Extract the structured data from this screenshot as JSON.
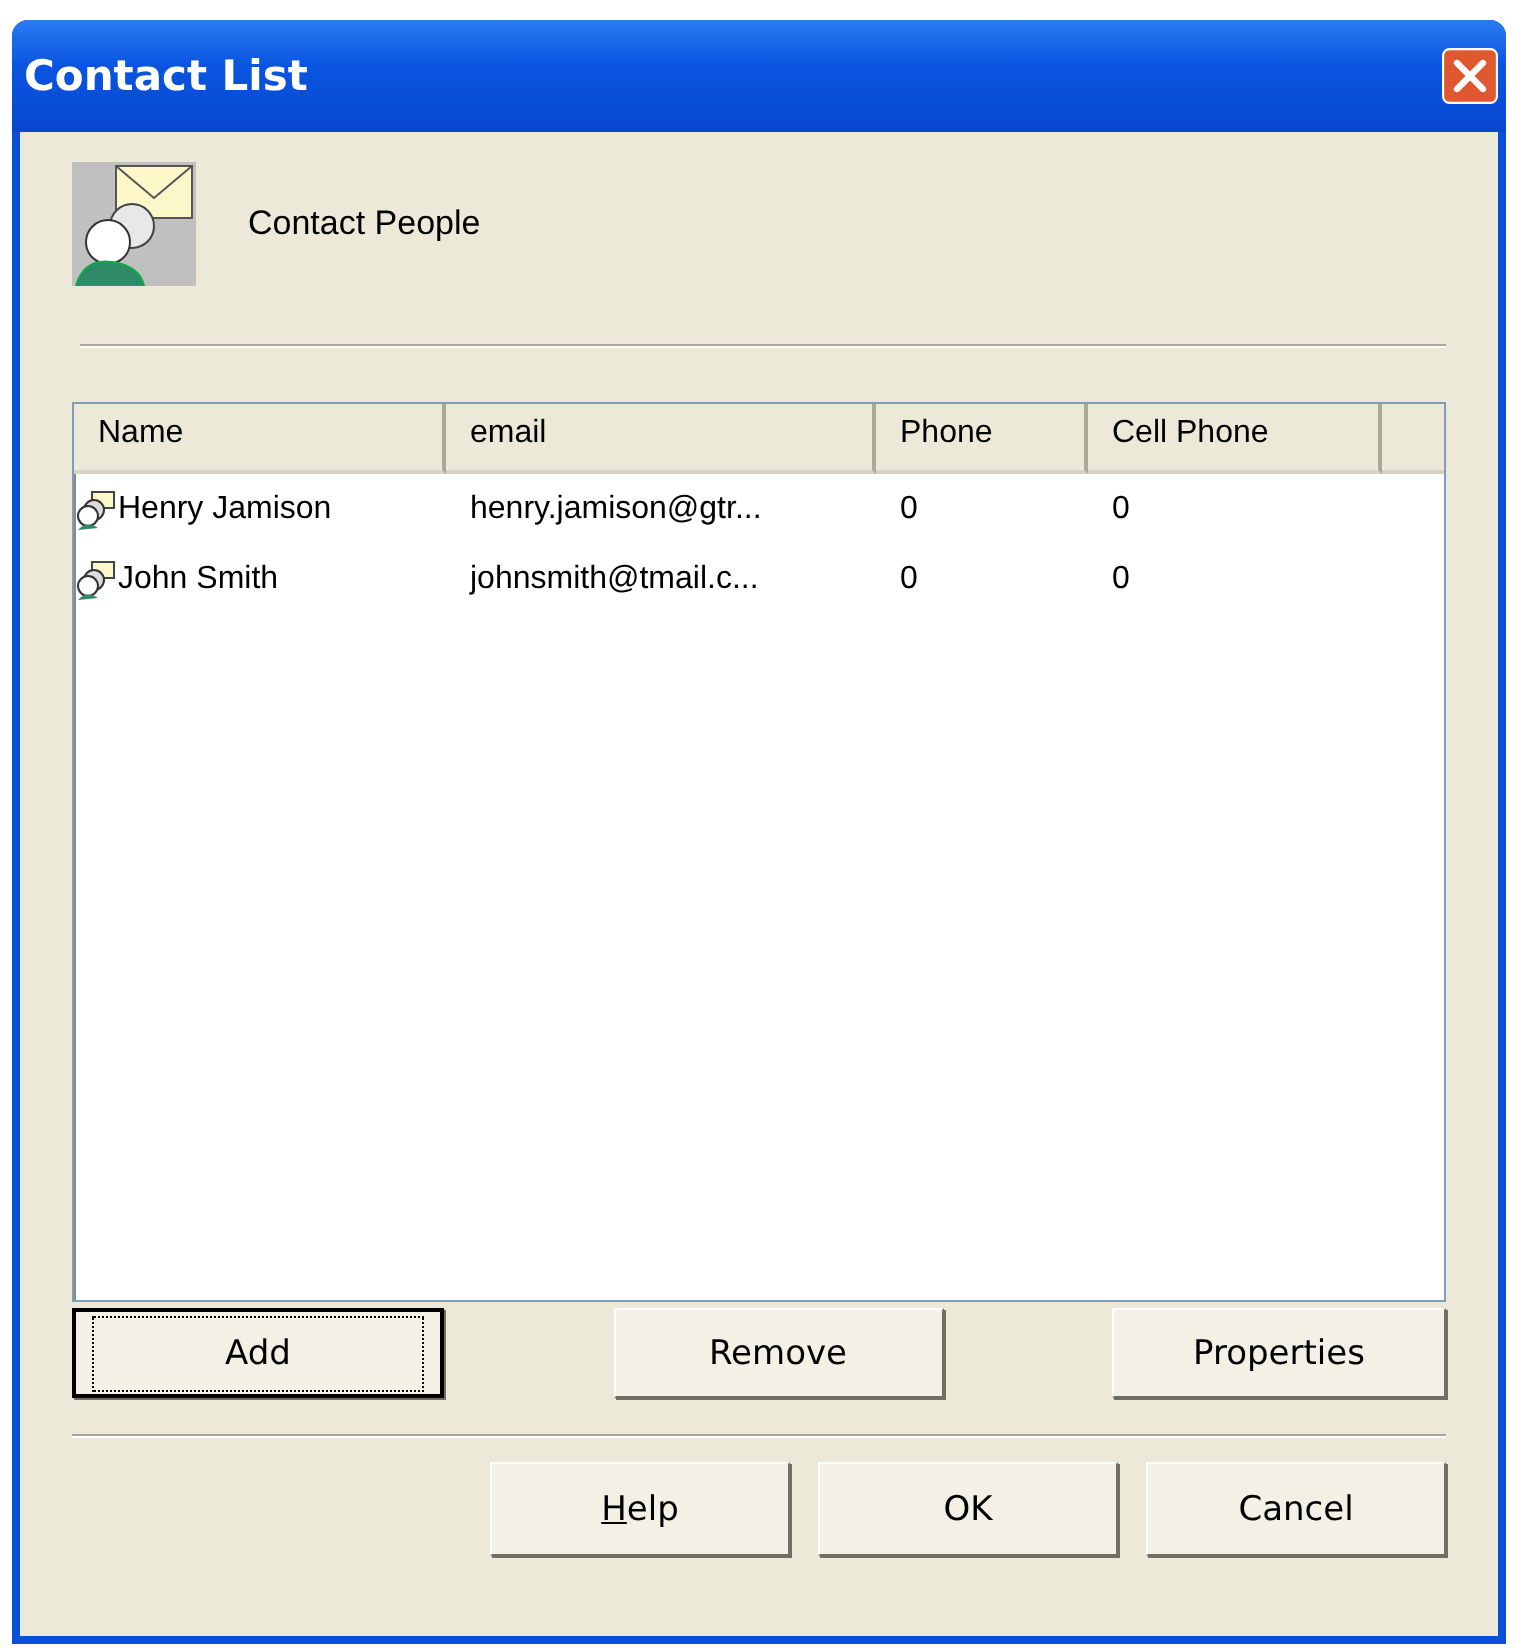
{
  "window": {
    "title": "Contact List"
  },
  "header": {
    "label": "Contact People"
  },
  "table": {
    "columns": [
      {
        "label": "Name"
      },
      {
        "label": "email"
      },
      {
        "label": "Phone"
      },
      {
        "label": "Cell Phone"
      }
    ],
    "rows": [
      {
        "cells": [
          "Henry Jamison",
          "henry.jamison@gtr...",
          "0",
          "0"
        ]
      },
      {
        "cells": [
          "John Smith",
          "johnsmith@tmail.c...",
          "0",
          "0"
        ]
      }
    ]
  },
  "list_buttons": [
    {
      "label": "Add",
      "focused": true,
      "underline_first": false
    },
    {
      "label": "Remove",
      "focused": false,
      "underline_first": false
    },
    {
      "label": "Properties",
      "focused": false,
      "underline_first": false
    }
  ],
  "dialog_buttons": [
    {
      "label": "Help",
      "focused": false,
      "underline_first": true
    },
    {
      "label": "OK",
      "focused": false,
      "underline_first": false
    },
    {
      "label": "Cancel",
      "focused": false,
      "underline_first": false
    }
  ]
}
